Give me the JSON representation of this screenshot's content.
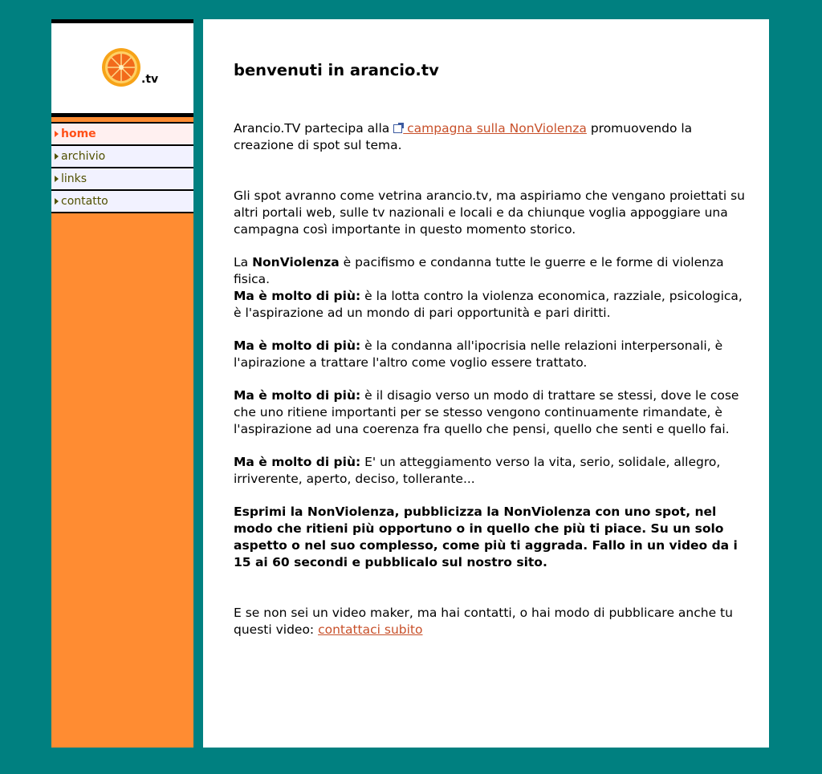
{
  "logo": {
    "text": ".tv"
  },
  "nav": [
    {
      "label": "home",
      "active": true
    },
    {
      "label": "archivio"
    },
    {
      "label": "links"
    },
    {
      "label": "contatto"
    }
  ],
  "main": {
    "title": "benvenuti in arancio.tv",
    "p1_before": "Arancio.TV partecipa alla ",
    "p1_link": " campagna sulla NonViolenza",
    "p1_after": " promuovendo la creazione di spot sul tema.",
    "p2": "Gli spot avranno come vetrina arancio.tv, ma aspiriamo che vengano proiettati su altri portali web, sulle tv nazionali e locali e da chiunque voglia appoggiare una campagna così importante in questo momento storico.",
    "p3_lead": "La ",
    "p3_bold": "NonViolenza",
    "p3_text": " è pacifismo e condanna tutte le guerre e le forme di violenza fisica.",
    "more_label": "Ma è molto di più:",
    "p3_more": " è la lotta contro la violenza economica, razziale, psicologica, è l'aspirazione ad un mondo di pari opportunità e pari diritti.",
    "p4_more": " è la condanna all'ipocrisia nelle relazioni interpersonali, è l'apirazione a trattare l'altro come voglio essere trattato.",
    "p5_more": " è il disagio verso un modo di trattare se stessi, dove le cose che uno ritiene importanti per se stesso vengono continuamente rimandate, è l'aspirazione ad una coerenza fra quello che pensi, quello che senti e quello fai.",
    "p6_more": " E' un atteggiamento verso la vita, serio, solidale, allegro, irriverente, aperto, deciso, tollerante...",
    "p7": "Esprimi la NonViolenza, pubblicizza la NonViolenza con uno spot, nel modo che ritieni più opportuno o in quello che più ti piace. Su un solo aspetto o nel suo complesso, come più ti aggrada. Fallo in un video da i 15 ai 60 secondi e pubblicalo sul nostro sito.",
    "p8_text": "E se non sei un video maker, ma hai contatti, o hai modo di pubblicare anche tu questi video: ",
    "p8_link": "contattaci subito"
  },
  "colors": {
    "page_bg": "#008080",
    "sidebar_bg": "#ff8c32",
    "link": "#c8502a",
    "nav_active": "#ff5018"
  }
}
